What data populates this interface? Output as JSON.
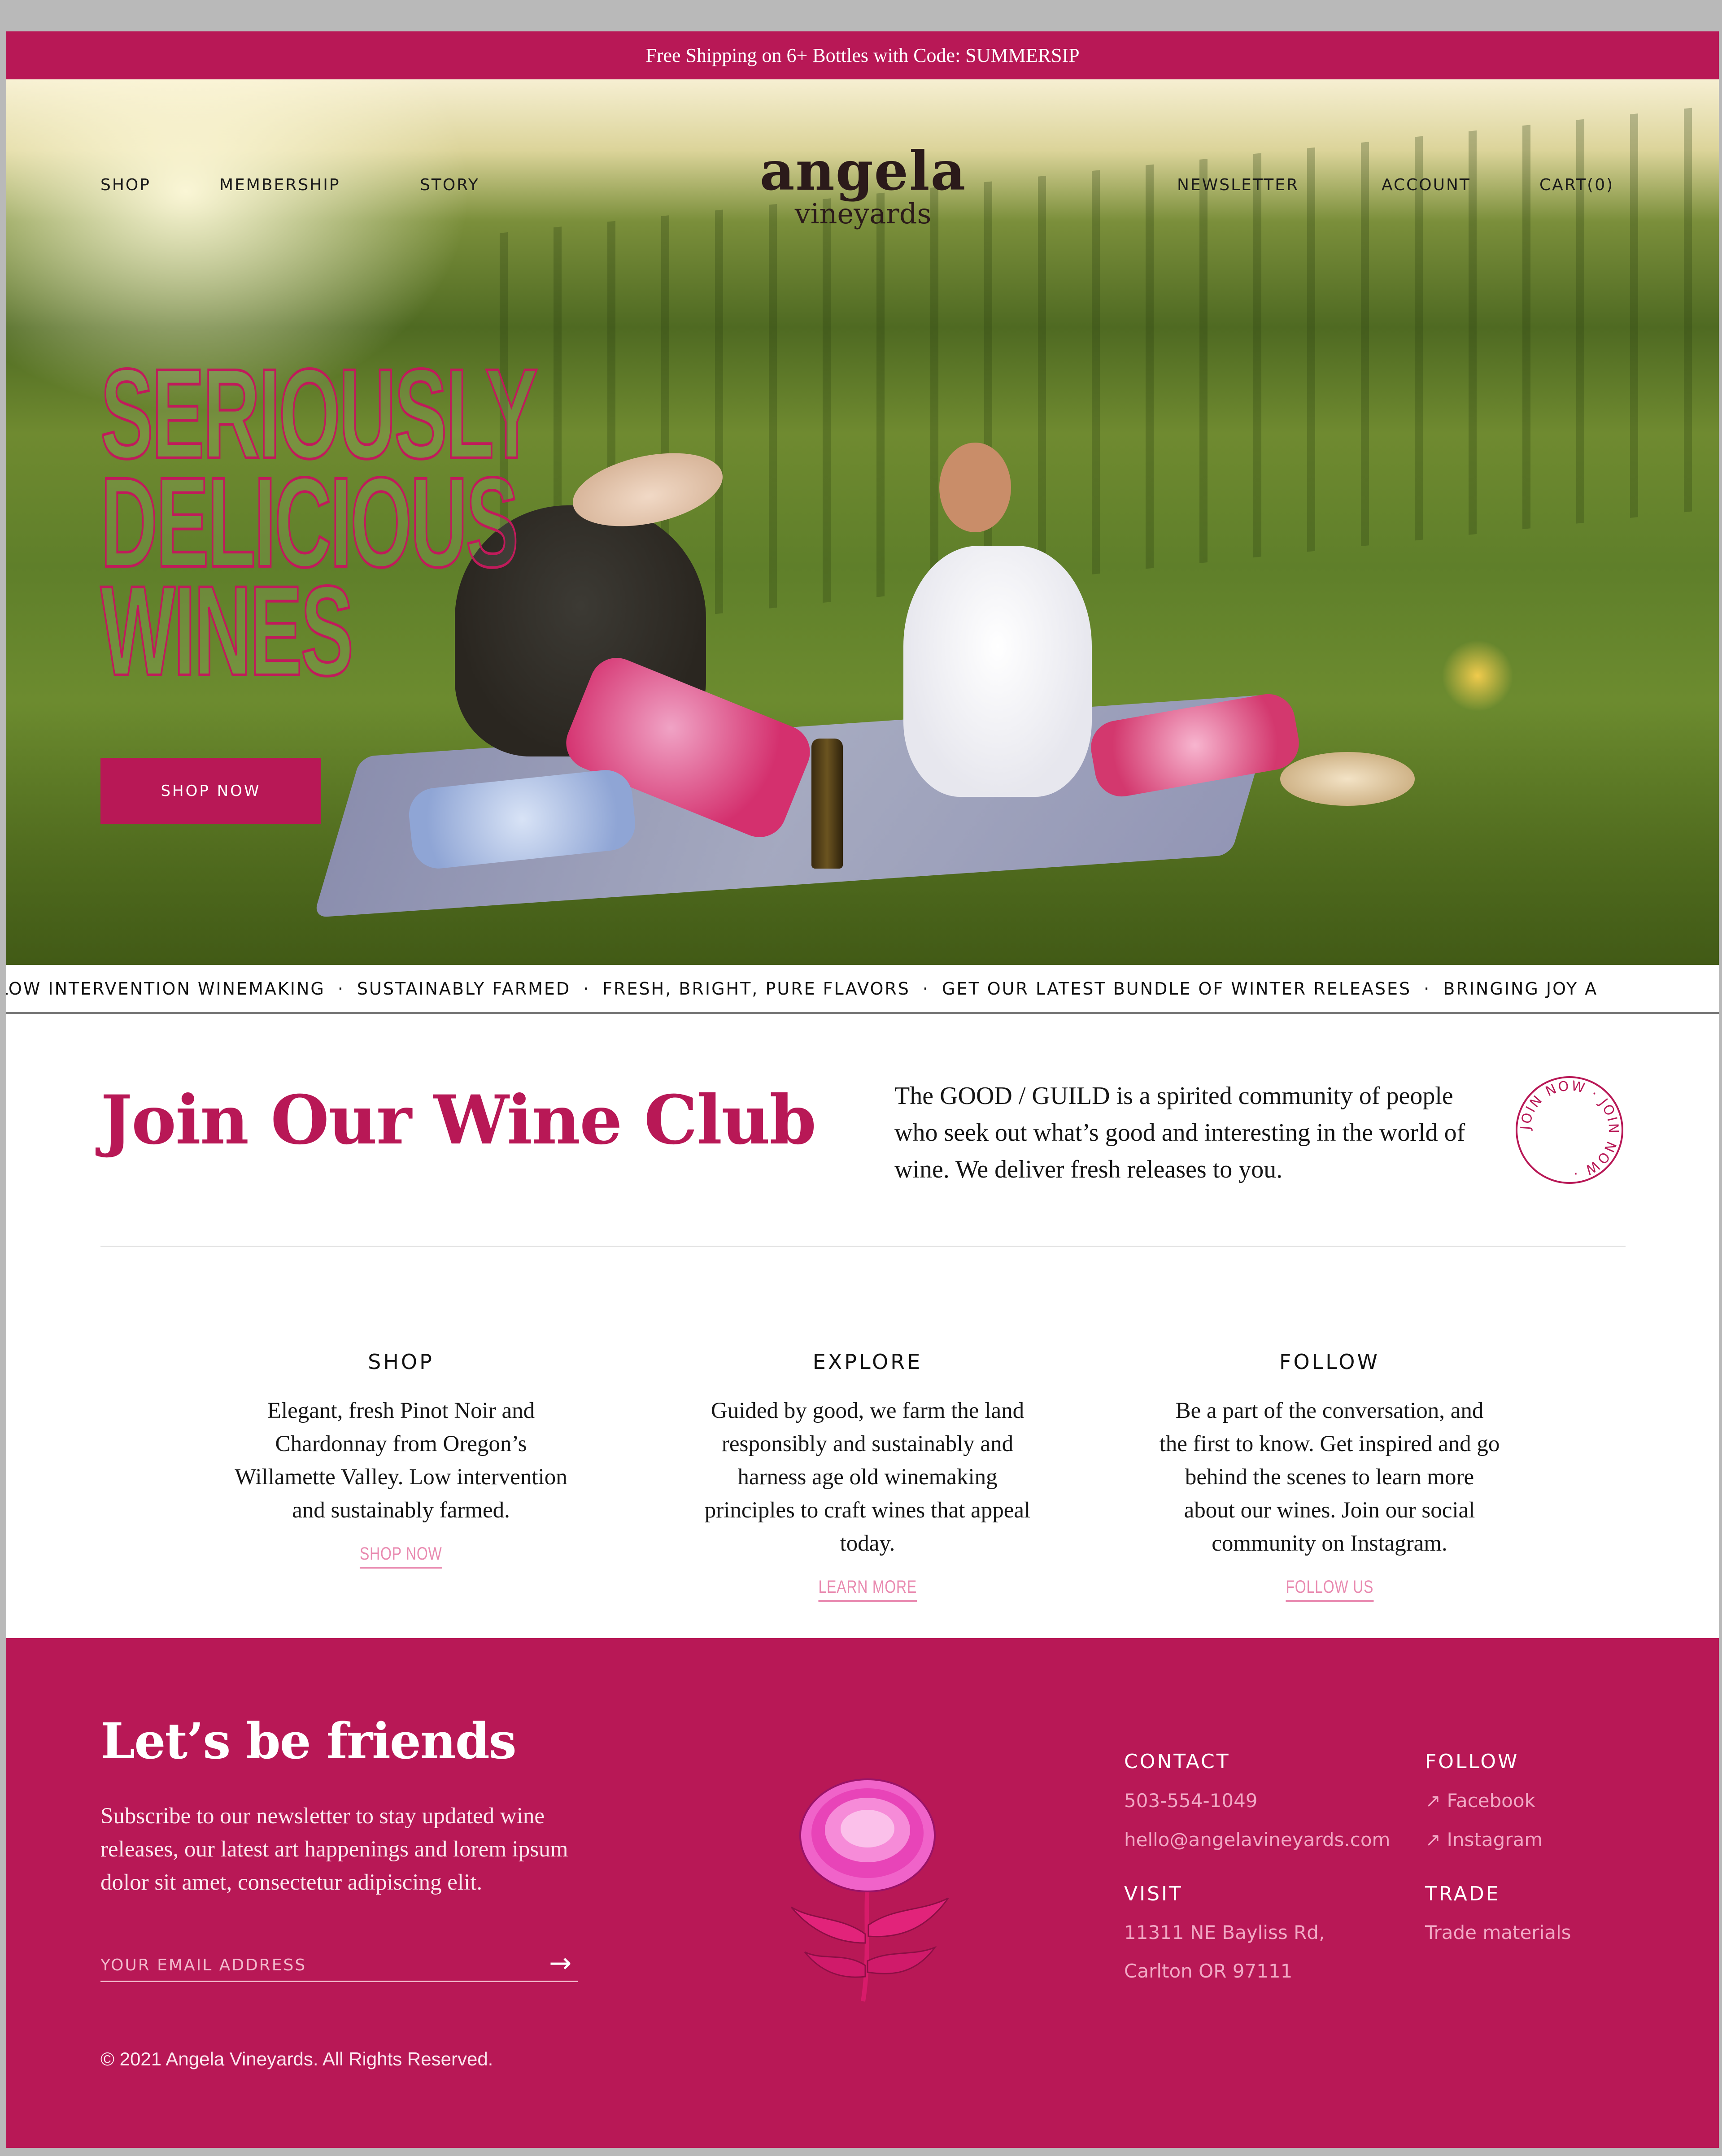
{
  "promo": {
    "text": "Free Shipping on 6+ Bottles with Code: SUMMERSIP"
  },
  "nav": {
    "left": [
      "SHOP",
      "MEMBERSHIP",
      "STORY"
    ],
    "right": [
      "NEWSLETTER",
      "ACCOUNT",
      "CART(0)"
    ]
  },
  "logo": {
    "line1": "angela",
    "line2": "vineyards"
  },
  "hero": {
    "headline": [
      "SERIOUSLY",
      "DELICIOUS",
      "WINES"
    ],
    "cta": "SHOP NOW"
  },
  "ticker": [
    "LOW INTERVENTION WINEMAKING",
    "SUSTAINABLY FARMED",
    "FRESH, BRIGHT, PURE FLAVORS",
    "GET OUR LATEST BUNDLE OF WINTER RELEASES",
    "BRINGING JOY A"
  ],
  "ticker_sep": "·",
  "club": {
    "title": "Join Our Wine Club",
    "text": "The GOOD / GUILD is a spirited community of people who seek out what’s good and interesting in the world of wine. We deliver fresh releases to you.",
    "badge": "JOIN NOW · JOIN NOW ·"
  },
  "columns": [
    {
      "title": "SHOP",
      "text": "Elegant, fresh Pinot Noir and Chardonnay from Oregon’s Willamette Valley. Low intervention and sustainably farmed.",
      "link": "SHOP NOW"
    },
    {
      "title": "EXPLORE",
      "text": "Guided by good, we farm the land responsibly and sustainably and harness age old winemaking principles to craft wines that appeal today.",
      "link": "LEARN MORE"
    },
    {
      "title": "FOLLOW",
      "text": "Be a part of the conversation, and the first to know. Get inspired and go behind the scenes to learn more about our wines. Join our social community on Instagram.",
      "link": "FOLLOW US"
    }
  ],
  "footer": {
    "title": "Let’s be friends",
    "text": "Subscribe to our newsletter to stay updated wine releases, our latest art happenings and lorem ipsum dolor sit amet, consectetur adipiscing elit.",
    "email_placeholder": "YOUR EMAIL ADDRESS",
    "copyright": "© 2021 Angela Vineyards. All Rights Reserved.",
    "contact": {
      "heading": "CONTACT",
      "phone": "503-554-1049",
      "email": "hello@angelavineyards.com"
    },
    "visit": {
      "heading": "VISIT",
      "line1": "11311 NE Bayliss Rd,",
      "line2": "Carlton OR 97111"
    },
    "follow": {
      "heading": "FOLLOW",
      "facebook": "↗ Facebook",
      "instagram": "↗ Instagram"
    },
    "trade": {
      "heading": "TRADE",
      "link": "Trade materials"
    }
  },
  "colors": {
    "brand": "#b81856",
    "link_pink": "#e98ab0"
  }
}
